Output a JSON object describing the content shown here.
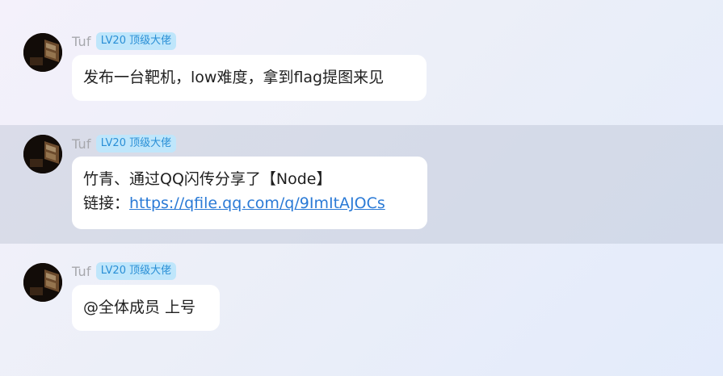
{
  "messages": [
    {
      "sender": "Tuf",
      "badge": "LV20 顶级大佬",
      "lines": [
        "发布一台靶机，low难度，拿到flag提图来见"
      ]
    },
    {
      "sender": "Tuf",
      "badge": "LV20 顶级大佬",
      "line1": "竹青、通过QQ闪传分享了【Node】",
      "link_prefix": "链接：",
      "link_url": "https://qfile.qq.com/q/9ImItAJOCs"
    },
    {
      "sender": "Tuf",
      "badge": "LV20 顶级大佬",
      "lines": [
        "@全体成员 上号"
      ]
    }
  ],
  "colors": {
    "badge_bg": "#bfe6fb",
    "badge_text": "#2a8fd6",
    "link": "#2a7ad6",
    "highlight_row": "#d5dbe6"
  },
  "icons": {
    "avatar": "user-avatar-image"
  }
}
